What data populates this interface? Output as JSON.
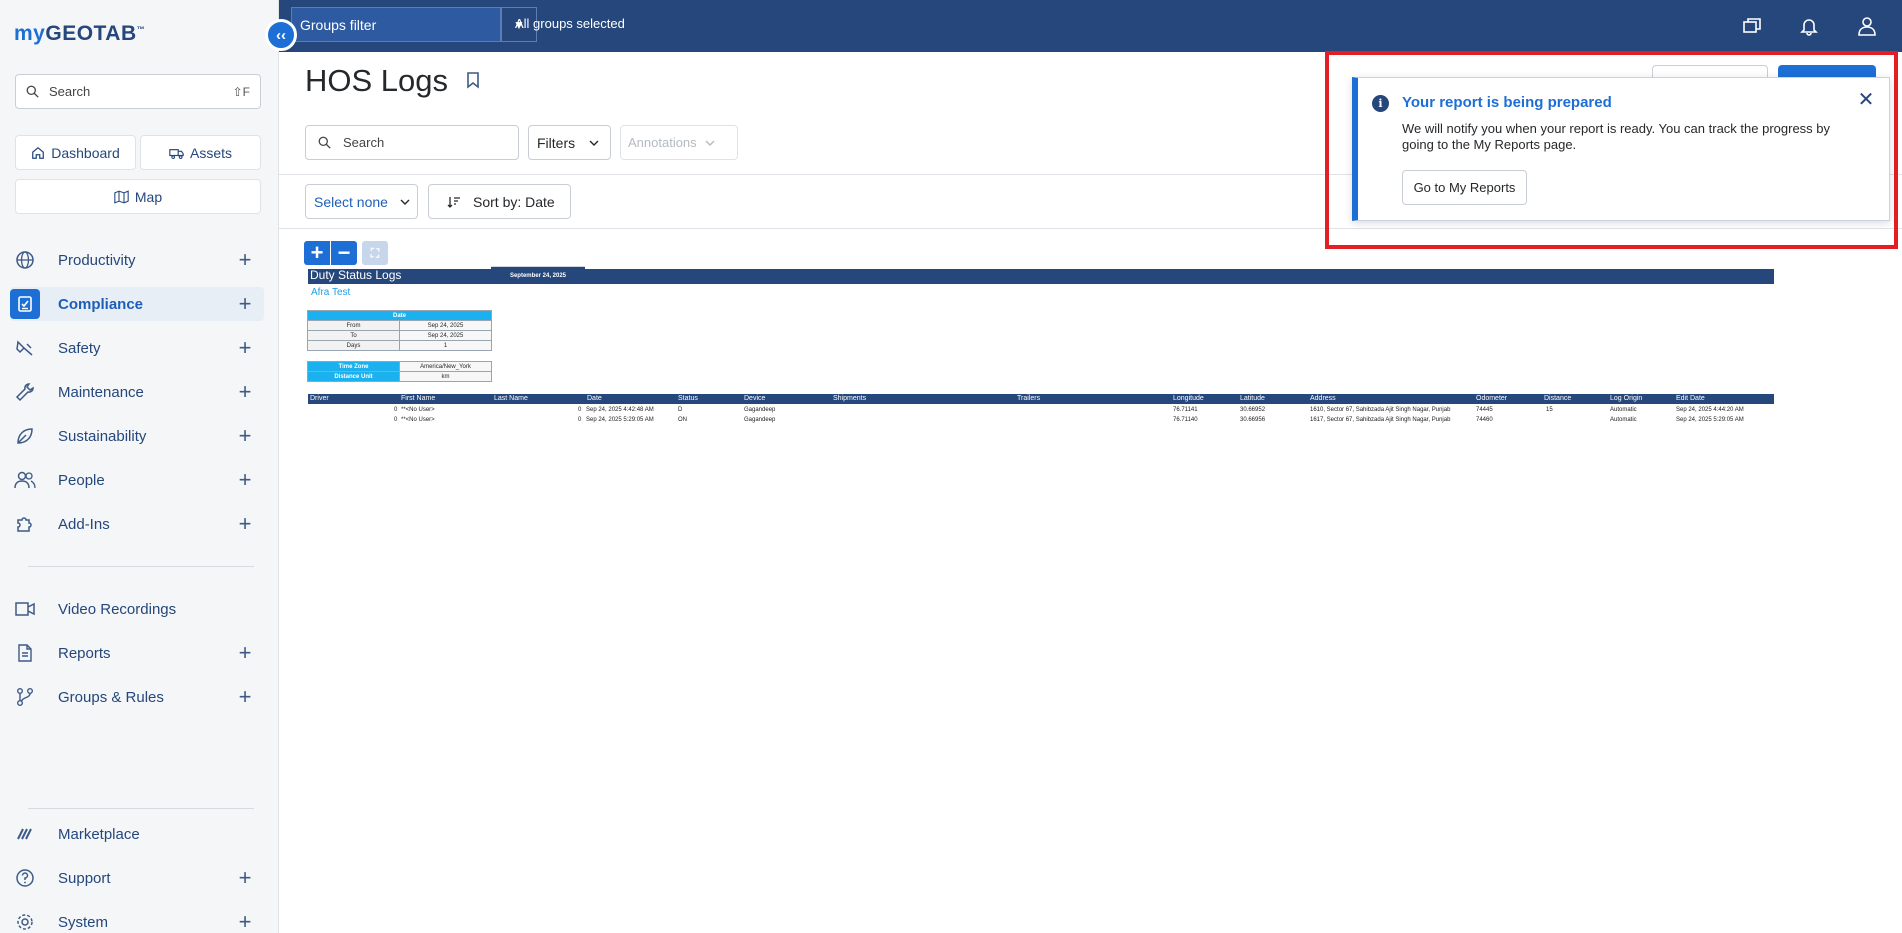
{
  "sidebar": {
    "logo_prefix": "my",
    "logo_brand": "GEOTAB",
    "search_placeholder": "Search",
    "search_shortcut": "⇧F",
    "quick_links": {
      "dashboard": "Dashboard",
      "assets": "Assets",
      "map": "Map"
    },
    "items": [
      {
        "label": "Productivity",
        "icon": "globe-icon",
        "expandable": true
      },
      {
        "label": "Compliance",
        "icon": "compliance-icon",
        "expandable": true,
        "active": true
      },
      {
        "label": "Safety",
        "icon": "safety-icon",
        "expandable": true
      },
      {
        "label": "Maintenance",
        "icon": "wrench-icon",
        "expandable": true
      },
      {
        "label": "Sustainability",
        "icon": "leaf-icon",
        "expandable": true
      },
      {
        "label": "People",
        "icon": "people-icon",
        "expandable": true
      },
      {
        "label": "Add-Ins",
        "icon": "puzzle-icon",
        "expandable": true
      },
      {
        "label": "Video Recordings",
        "icon": "video-icon",
        "expandable": false
      },
      {
        "label": "Reports",
        "icon": "document-icon",
        "expandable": true
      },
      {
        "label": "Groups & Rules",
        "icon": "groups-icon",
        "expandable": true
      },
      {
        "label": "Marketplace",
        "icon": "marketplace-icon",
        "expandable": false
      },
      {
        "label": "Support",
        "icon": "help-icon",
        "expandable": true
      },
      {
        "label": "System",
        "icon": "gear-icon",
        "expandable": true
      }
    ]
  },
  "topbar": {
    "groups_filter": "Groups filter",
    "groups_selected": "All groups selected"
  },
  "page": {
    "title": "HOS Logs",
    "search_placeholder": "Search",
    "filters_label": "Filters",
    "annotations_label": "Annotations",
    "select_none": "Select none",
    "sort_label": "Sort by: Date"
  },
  "report": {
    "title": "Duty Status Logs",
    "date_header": "September 24, 2025",
    "subtitle": "Afra Test",
    "date_table": {
      "header": "Date",
      "rows": [
        {
          "label": "From",
          "value": "Sep 24, 2025"
        },
        {
          "label": "To",
          "value": "Sep 24, 2025"
        },
        {
          "label": "Days",
          "value": "1"
        }
      ]
    },
    "settings_table": [
      {
        "label": "Time Zone",
        "value": "America/New_York"
      },
      {
        "label": "Distance Unit",
        "value": "km"
      }
    ],
    "columns": [
      "Driver",
      "First Name",
      "Last Name",
      "Date",
      "Status",
      "Device",
      "Shipments",
      "Trailers",
      "Longitude",
      "Latitude",
      "Address",
      "Odometer",
      "Distance",
      "Log Origin",
      "Edit Date"
    ],
    "rows": [
      {
        "num": "0",
        "first": "**<No User>",
        "date_num": "0",
        "date": "Sep 24, 2025 4:42:48 AM",
        "status": "D",
        "device": "Gagandeep",
        "lon": "76.71141",
        "lat": "30.66952",
        "address": "1610, Sector 67, Sahibzada Ajit Singh Nagar, Punjab",
        "odometer": "74445",
        "distance": "15",
        "origin": "Automatic",
        "edit": "Sep 24, 2025 4:44:20 AM"
      },
      {
        "num": "0",
        "first": "**<No User>",
        "date_num": "0",
        "date": "Sep 24, 2025 5:29:05 AM",
        "status": "ON",
        "device": "Gagandeep",
        "lon": "76.71140",
        "lat": "30.66956",
        "address": "1617, Sector 67, Sahibzada Ajit Singh Nagar, Punjab",
        "odometer": "74460",
        "distance": "",
        "origin": "Automatic",
        "edit": "Sep 24, 2025 5:29:05 AM"
      }
    ]
  },
  "toast": {
    "title": "Your report is being prepared",
    "message": "We will notify you when your report is ready. You can track the progress by going to the My Reports page.",
    "button": "Go to My Reports"
  },
  "colors": {
    "brand_navy": "#25477b",
    "accent_blue": "#1d6fd6",
    "highlight_red": "#e31e24",
    "table_cyan": "#1bb0ee"
  }
}
